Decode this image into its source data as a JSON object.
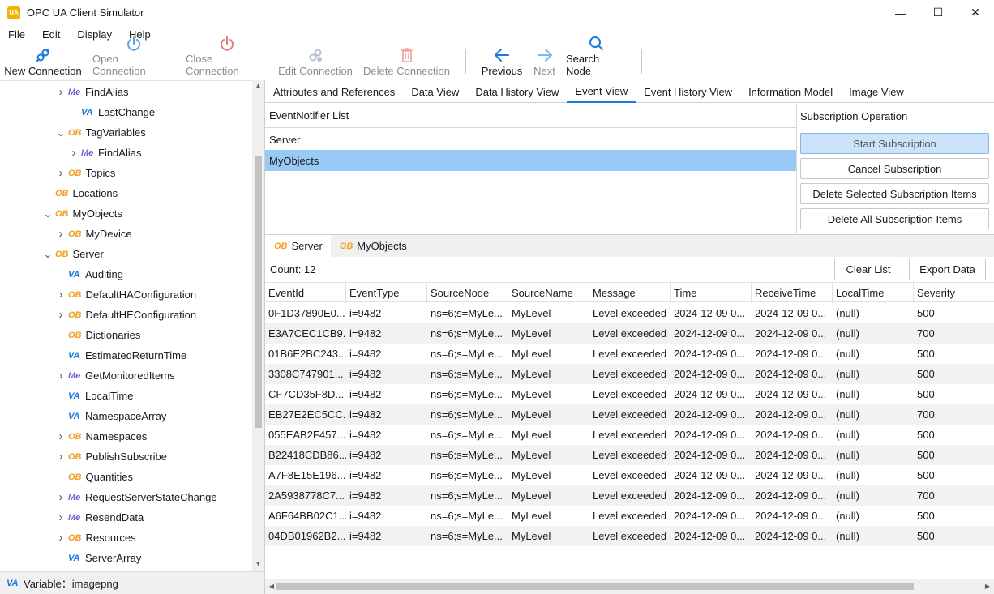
{
  "window": {
    "title": "OPC UA Client Simulator",
    "app_icon_text": "UA",
    "controls": [
      "—",
      "☐",
      "✕"
    ]
  },
  "menu": [
    "File",
    "Edit",
    "Display",
    "Help"
  ],
  "toolbar": {
    "new_connection": "New Connection",
    "open_connection": "Open Connection",
    "close_connection": "Close Connection",
    "edit_connection": "Edit Connection",
    "delete_connection": "Delete Connection",
    "previous": "Previous",
    "next": "Next",
    "search_node": "Search Node"
  },
  "tree": {
    "items": [
      {
        "label": "FindAlias",
        "icon": "Me",
        "expand": "collapsed"
      },
      {
        "label": "LastChange",
        "icon": "VA",
        "expand": "none"
      },
      {
        "label": "TagVariables",
        "icon": "OB",
        "expand": "expanded"
      },
      {
        "label": "FindAlias",
        "icon": "Me",
        "expand": "collapsed"
      },
      {
        "label": "Topics",
        "icon": "OB",
        "expand": "collapsed"
      },
      {
        "label": "Locations",
        "icon": "OB",
        "expand": "none"
      },
      {
        "label": "MyObjects",
        "icon": "OB",
        "expand": "expanded"
      },
      {
        "label": "MyDevice",
        "icon": "OB",
        "expand": "collapsed"
      },
      {
        "label": "Server",
        "icon": "OB",
        "expand": "expanded"
      },
      {
        "label": "Auditing",
        "icon": "VA",
        "expand": "none"
      },
      {
        "label": "DefaultHAConfiguration",
        "icon": "OB",
        "expand": "collapsed"
      },
      {
        "label": "DefaultHEConfiguration",
        "icon": "OB",
        "expand": "collapsed"
      },
      {
        "label": "Dictionaries",
        "icon": "OB",
        "expand": "none"
      },
      {
        "label": "EstimatedReturnTime",
        "icon": "VA",
        "expand": "none"
      },
      {
        "label": "GetMonitoredItems",
        "icon": "Me",
        "expand": "collapsed"
      },
      {
        "label": "LocalTime",
        "icon": "VA",
        "expand": "none"
      },
      {
        "label": "NamespaceArray",
        "icon": "VA",
        "expand": "none"
      },
      {
        "label": "Namespaces",
        "icon": "OB",
        "expand": "collapsed"
      },
      {
        "label": "PublishSubscribe",
        "icon": "OB",
        "expand": "collapsed"
      },
      {
        "label": "Quantities",
        "icon": "OB",
        "expand": "none"
      },
      {
        "label": "RequestServerStateChange",
        "icon": "Me",
        "expand": "collapsed"
      },
      {
        "label": "ResendData",
        "icon": "Me",
        "expand": "collapsed"
      },
      {
        "label": "Resources",
        "icon": "OB",
        "expand": "collapsed"
      },
      {
        "label": "ServerArray",
        "icon": "VA",
        "expand": "none"
      }
    ]
  },
  "status": {
    "icon": "VA",
    "text": "Variable：imagepng"
  },
  "tabs": [
    "Attributes and References",
    "Data View",
    "Data History View",
    "Event View",
    "Event History View",
    "Information Model",
    "Image View"
  ],
  "active_tab": "Event View",
  "event_notifier": {
    "header": "EventNotifier List",
    "items": [
      "Server",
      "MyObjects"
    ],
    "selected": "MyObjects"
  },
  "subscription": {
    "header": "Subscription Operation",
    "start": "Start Subscription",
    "cancel": "Cancel Subscription",
    "delete_selected": "Delete Selected Subscription Items",
    "delete_all": "Delete All Subscription Items"
  },
  "subtabs": [
    {
      "icon": "OB",
      "label": "Server"
    },
    {
      "icon": "OB",
      "label": "MyObjects"
    }
  ],
  "count_label": "Count:  12",
  "clear_list": "Clear List",
  "export_data": "Export Data",
  "grid": {
    "columns": [
      "EventId",
      "EventType",
      "SourceNode",
      "SourceName",
      "Message",
      "Time",
      "ReceiveTime",
      "LocalTime",
      "Severity"
    ],
    "rows": [
      [
        "0F1D37890E0...",
        "i=9482",
        "ns=6;s=MyLe...",
        "MyLevel",
        "Level exceeded",
        "2024-12-09 0...",
        "2024-12-09 0...",
        "(null)",
        "500"
      ],
      [
        "E3A7CEC1CB9...",
        "i=9482",
        "ns=6;s=MyLe...",
        "MyLevel",
        "Level exceeded",
        "2024-12-09 0...",
        "2024-12-09 0...",
        "(null)",
        "700"
      ],
      [
        "01B6E2BC243...",
        "i=9482",
        "ns=6;s=MyLe...",
        "MyLevel",
        "Level exceeded",
        "2024-12-09 0...",
        "2024-12-09 0...",
        "(null)",
        "500"
      ],
      [
        "3308C747901...",
        "i=9482",
        "ns=6;s=MyLe...",
        "MyLevel",
        "Level exceeded",
        "2024-12-09 0...",
        "2024-12-09 0...",
        "(null)",
        "500"
      ],
      [
        "CF7CD35F8D...",
        "i=9482",
        "ns=6;s=MyLe...",
        "MyLevel",
        "Level exceeded",
        "2024-12-09 0...",
        "2024-12-09 0...",
        "(null)",
        "500"
      ],
      [
        "EB27E2EC5CC...",
        "i=9482",
        "ns=6;s=MyLe...",
        "MyLevel",
        "Level exceeded",
        "2024-12-09 0...",
        "2024-12-09 0...",
        "(null)",
        "700"
      ],
      [
        "055EAB2F457...",
        "i=9482",
        "ns=6;s=MyLe...",
        "MyLevel",
        "Level exceeded",
        "2024-12-09 0...",
        "2024-12-09 0...",
        "(null)",
        "500"
      ],
      [
        "B22418CDB86...",
        "i=9482",
        "ns=6;s=MyLe...",
        "MyLevel",
        "Level exceeded",
        "2024-12-09 0...",
        "2024-12-09 0...",
        "(null)",
        "500"
      ],
      [
        "A7F8E15E196...",
        "i=9482",
        "ns=6;s=MyLe...",
        "MyLevel",
        "Level exceeded",
        "2024-12-09 0...",
        "2024-12-09 0...",
        "(null)",
        "500"
      ],
      [
        "2A5938778C7...",
        "i=9482",
        "ns=6;s=MyLe...",
        "MyLevel",
        "Level exceeded",
        "2024-12-09 0...",
        "2024-12-09 0...",
        "(null)",
        "700"
      ],
      [
        "A6F64BB02C1...",
        "i=9482",
        "ns=6;s=MyLe...",
        "MyLevel",
        "Level exceeded",
        "2024-12-09 0...",
        "2024-12-09 0...",
        "(null)",
        "500"
      ],
      [
        "04DB01962B2...",
        "i=9482",
        "ns=6;s=MyLe...",
        "MyLevel",
        "Level exceeded",
        "2024-12-09 0...",
        "2024-12-09 0...",
        "(null)",
        "500"
      ]
    ]
  },
  "colors": {
    "accent": "#1e7ae0",
    "selection": "#99c9f7",
    "object_icon": "#f0a020",
    "variable_icon": "#1e7ae0",
    "method_icon": "#6a5acd"
  }
}
